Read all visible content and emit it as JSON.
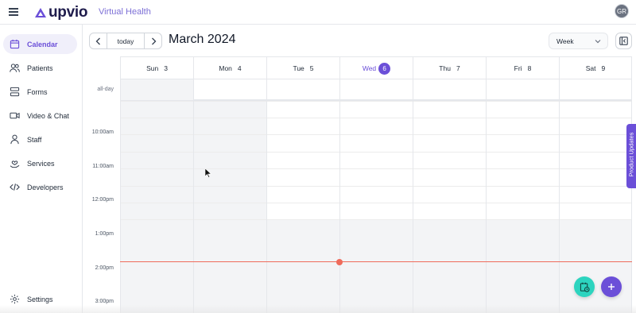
{
  "app": {
    "logo_text": "upvio",
    "product": "Virtual Health",
    "avatar_initials": "GR",
    "accent": "#6b4fd8"
  },
  "sidebar": {
    "items": [
      {
        "label": "Calendar",
        "icon": "calendar-icon",
        "active": true
      },
      {
        "label": "Patients",
        "icon": "users-icon"
      },
      {
        "label": "Forms",
        "icon": "forms-icon"
      },
      {
        "label": "Video & Chat",
        "icon": "video-icon"
      },
      {
        "label": "Staff",
        "icon": "staff-icon"
      },
      {
        "label": "Services",
        "icon": "hand-heart-icon"
      },
      {
        "label": "Developers",
        "icon": "code-icon"
      }
    ],
    "settings_label": "Settings"
  },
  "toolbar": {
    "today_label": "today",
    "month_title": "March 2024",
    "view_label": "Week"
  },
  "days": [
    {
      "name": "Sun",
      "num": "3"
    },
    {
      "name": "Mon",
      "num": "4"
    },
    {
      "name": "Tue",
      "num": "5"
    },
    {
      "name": "Wed",
      "num": "6",
      "today": true
    },
    {
      "name": "Thu",
      "num": "7"
    },
    {
      "name": "Fri",
      "num": "8"
    },
    {
      "name": "Sat",
      "num": "9"
    }
  ],
  "allday_label": "all-day",
  "times": [
    "10:00am",
    "11:00am",
    "12:00pm",
    "1:00pm",
    "2:00pm",
    "3:00pm"
  ],
  "product_updates_label": "Product Updates"
}
